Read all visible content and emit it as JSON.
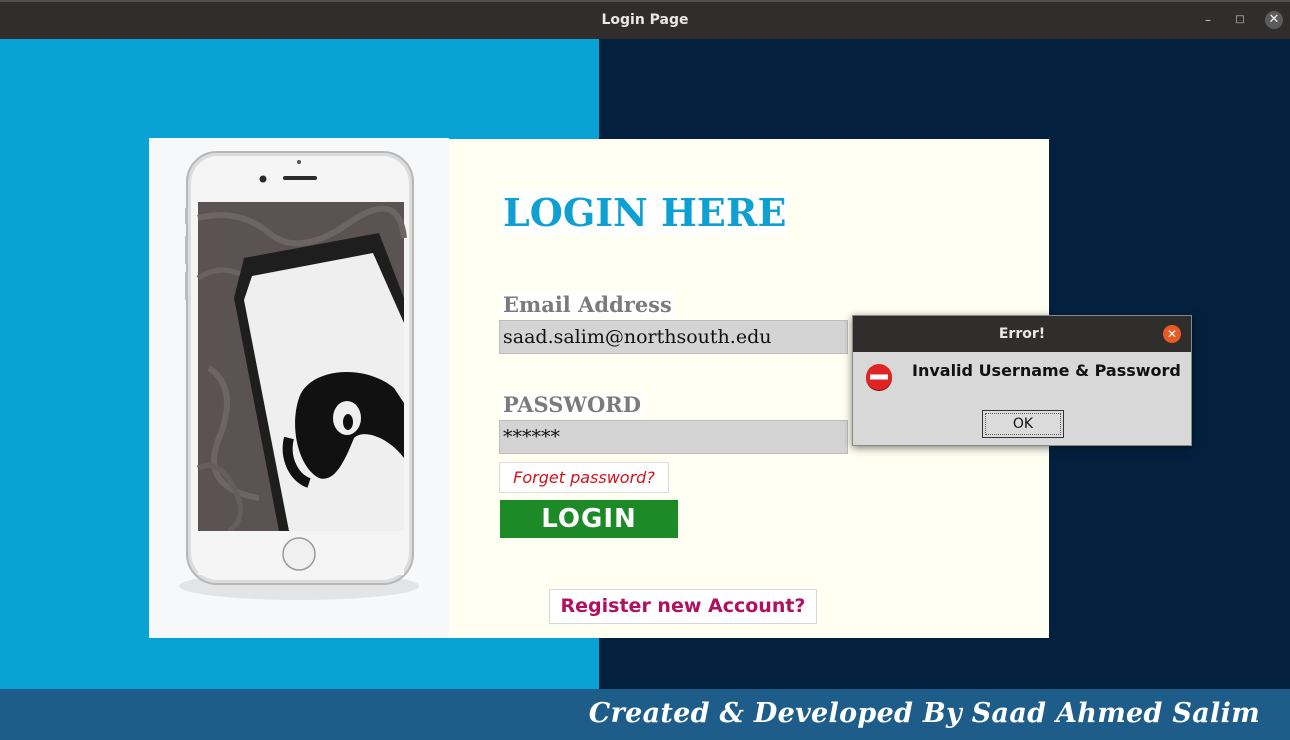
{
  "window": {
    "title": "Login Page",
    "minimize_icon": "minimize-icon",
    "maximize_icon": "maximize-icon",
    "close_icon": "close-icon"
  },
  "colors": {
    "left_background": "#09a2d4",
    "right_background": "#03213f",
    "form_background": "#fffff2",
    "title_color": "#0ea0d3",
    "login_button": "#1b8a27",
    "forget_link": "#d4131a",
    "register_link": "#b0105e",
    "footer": "#1e5d8a"
  },
  "form": {
    "heading": "LOGIN HERE",
    "email_label": "Email Address",
    "email_value": "saad.salim@northsouth.edu",
    "password_label": "PASSWORD",
    "password_value": "******",
    "forget_label": "Forget password?",
    "login_label": "LOGIN",
    "register_label": "Register new Account?"
  },
  "dialog": {
    "title": "Error!",
    "message": "Invalid Username & Password",
    "ok_label": "OK",
    "icon": "error-icon"
  },
  "footer": {
    "credit": "Created & Developed By Saad Ahmed Salim"
  }
}
